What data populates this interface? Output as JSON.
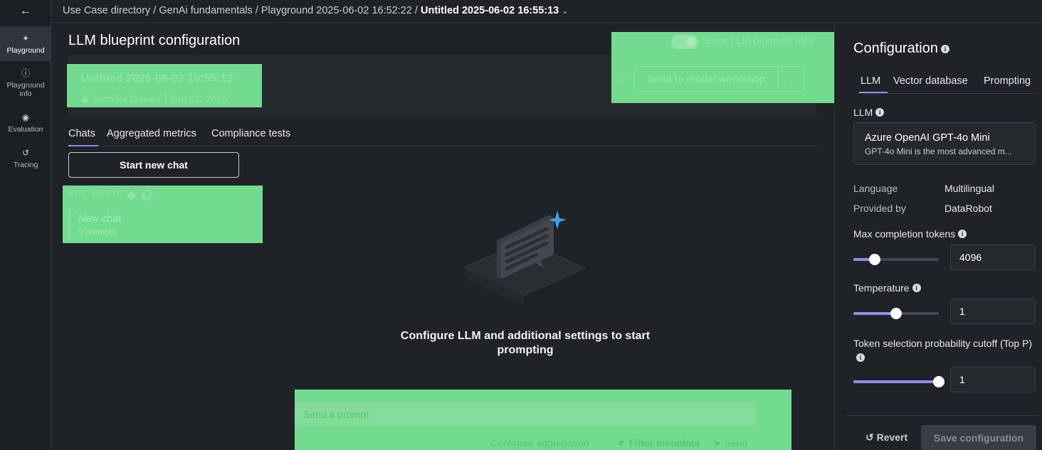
{
  "nav": {
    "back_icon": "arrow-left-icon",
    "items": [
      {
        "label": "Playground",
        "icon": "sparkle-icon"
      },
      {
        "label": "Playground info",
        "icon": "info-circle-icon"
      },
      {
        "label": "Evaluation",
        "icon": "target-icon"
      },
      {
        "label": "Tracing",
        "icon": "history-icon"
      }
    ]
  },
  "breadcrumb": {
    "items": [
      "Use Case directory",
      "GenAi fundamentals",
      "Playground 2025-06-02 16:52:22"
    ],
    "separator": " / ",
    "current": "Untitled 2025-06-02 16:55:13"
  },
  "main": {
    "title": "LLM blueprint configuration",
    "blueprint": {
      "name": "Untitled 2025-06-02 16:55:13",
      "author": "Jennifer Davies",
      "date": "Jun 02, 2025"
    },
    "show_info_label": "Show LLM blueprint info",
    "send_workshop_label": "Send to model workshop",
    "tabs": [
      "Chats",
      "Aggregated metrics",
      "Compliance tests"
    ],
    "start_chat_label": "Start new chat",
    "all_chats_label": "ALL CHATS",
    "all_chats_count": "1",
    "chats": [
      {
        "title": "New chat",
        "subtitle": "0 prompts"
      }
    ],
    "empty_message": "Configure LLM and additional settings to start prompting",
    "prompt_placeholder": "Send a prompt",
    "configure_aggregation_label": "Configure aggregation",
    "filter_metadata_label": "Filter metadata",
    "send_label": "Send"
  },
  "config": {
    "title": "Configuration",
    "tabs": [
      "LLM",
      "Vector database",
      "Prompting"
    ],
    "llm_label": "LLM",
    "llm_name": "Azure OpenAI GPT-4o Mini",
    "llm_desc": "GPT-4o Mini is the most advanced m...",
    "language_label": "Language",
    "language_value": "Multilingual",
    "provided_label": "Provided by",
    "provided_value": "DataRobot",
    "max_tokens_label": "Max completion tokens",
    "max_tokens_value": "4096",
    "max_tokens_fraction": 0.25,
    "temperature_label": "Temperature",
    "temperature_value": "1",
    "temperature_fraction": 0.5,
    "top_p_label": "Token selection probability cutoff (Top P)",
    "top_p_value": "1",
    "top_p_fraction": 1.0,
    "revert_label": "Revert",
    "save_label": "Save configuration"
  },
  "colors": {
    "accent": "#8b8ff0",
    "highlight": "#73db8f",
    "background": "#1f2226"
  }
}
